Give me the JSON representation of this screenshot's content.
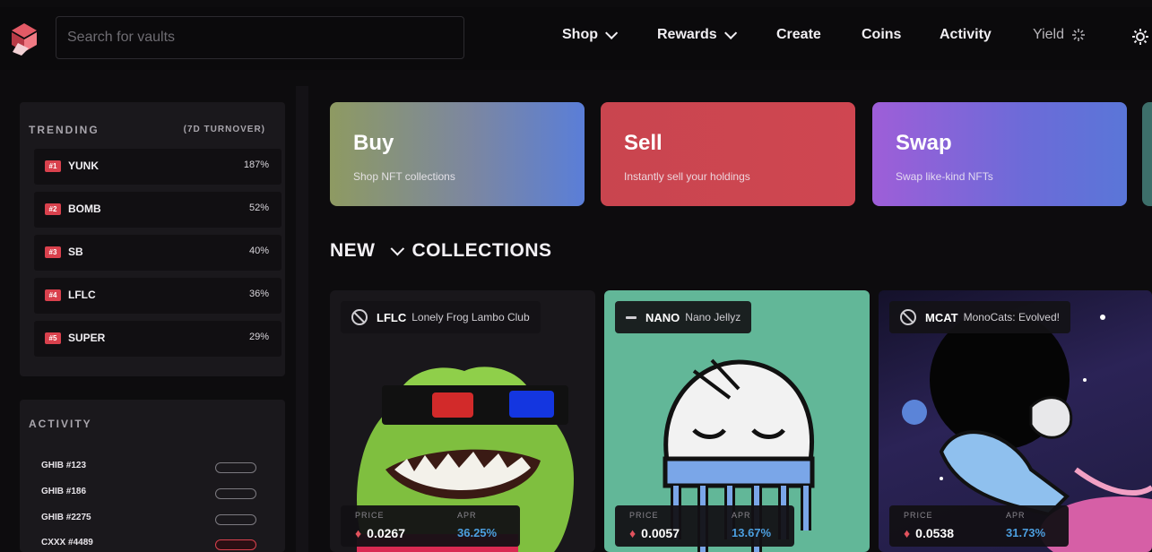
{
  "header": {
    "search_placeholder": "Search for vaults",
    "nav": [
      {
        "label": "Shop"
      },
      {
        "label": "Rewards"
      },
      {
        "label": "Create"
      },
      {
        "label": "Coins"
      },
      {
        "label": "Activity"
      },
      {
        "label": "Yield"
      }
    ],
    "accent": "#d9414d"
  },
  "trending": {
    "title": "TRENDING",
    "subtitle": "(7D TURNOVER)",
    "items": [
      {
        "rank": "#1",
        "symbol": "YUNK",
        "value": "187%"
      },
      {
        "rank": "#2",
        "symbol": "BOMB",
        "value": "52%"
      },
      {
        "rank": "#3",
        "symbol": "SB",
        "value": "40%"
      },
      {
        "rank": "#4",
        "symbol": "LFLC",
        "value": "36%"
      },
      {
        "rank": "#5",
        "symbol": "SUPER",
        "value": "29%"
      }
    ]
  },
  "activity": {
    "title": "ACTIVITY",
    "items": [
      {
        "name": "GHIB #123"
      },
      {
        "name": "GHIB #186"
      },
      {
        "name": "GHIB #2275"
      },
      {
        "name": "CXXX #4489"
      }
    ]
  },
  "actions": [
    {
      "title": "Buy",
      "subtitle": "Shop NFT collections"
    },
    {
      "title": "Sell",
      "subtitle": "Instantly sell your holdings"
    },
    {
      "title": "Swap",
      "subtitle": "Swap like-kind NFTs"
    }
  ],
  "section": {
    "filter": "NEW",
    "title": "COLLECTIONS"
  },
  "collections": [
    {
      "symbol": "LFLC",
      "name": "Lonely Frog Lambo Club",
      "price_label": "PRICE",
      "price": "0.0267",
      "apr_label": "APR",
      "apr": "36.25%"
    },
    {
      "symbol": "NANO",
      "name": "Nano Jellyz",
      "price_label": "PRICE",
      "price": "0.0057",
      "apr_label": "APR",
      "apr": "13.67%"
    },
    {
      "symbol": "MCAT",
      "name": "MonoCats: Evolved!",
      "price_label": "PRICE",
      "price": "0.0538",
      "apr_label": "APR",
      "apr": "31.73%"
    }
  ]
}
